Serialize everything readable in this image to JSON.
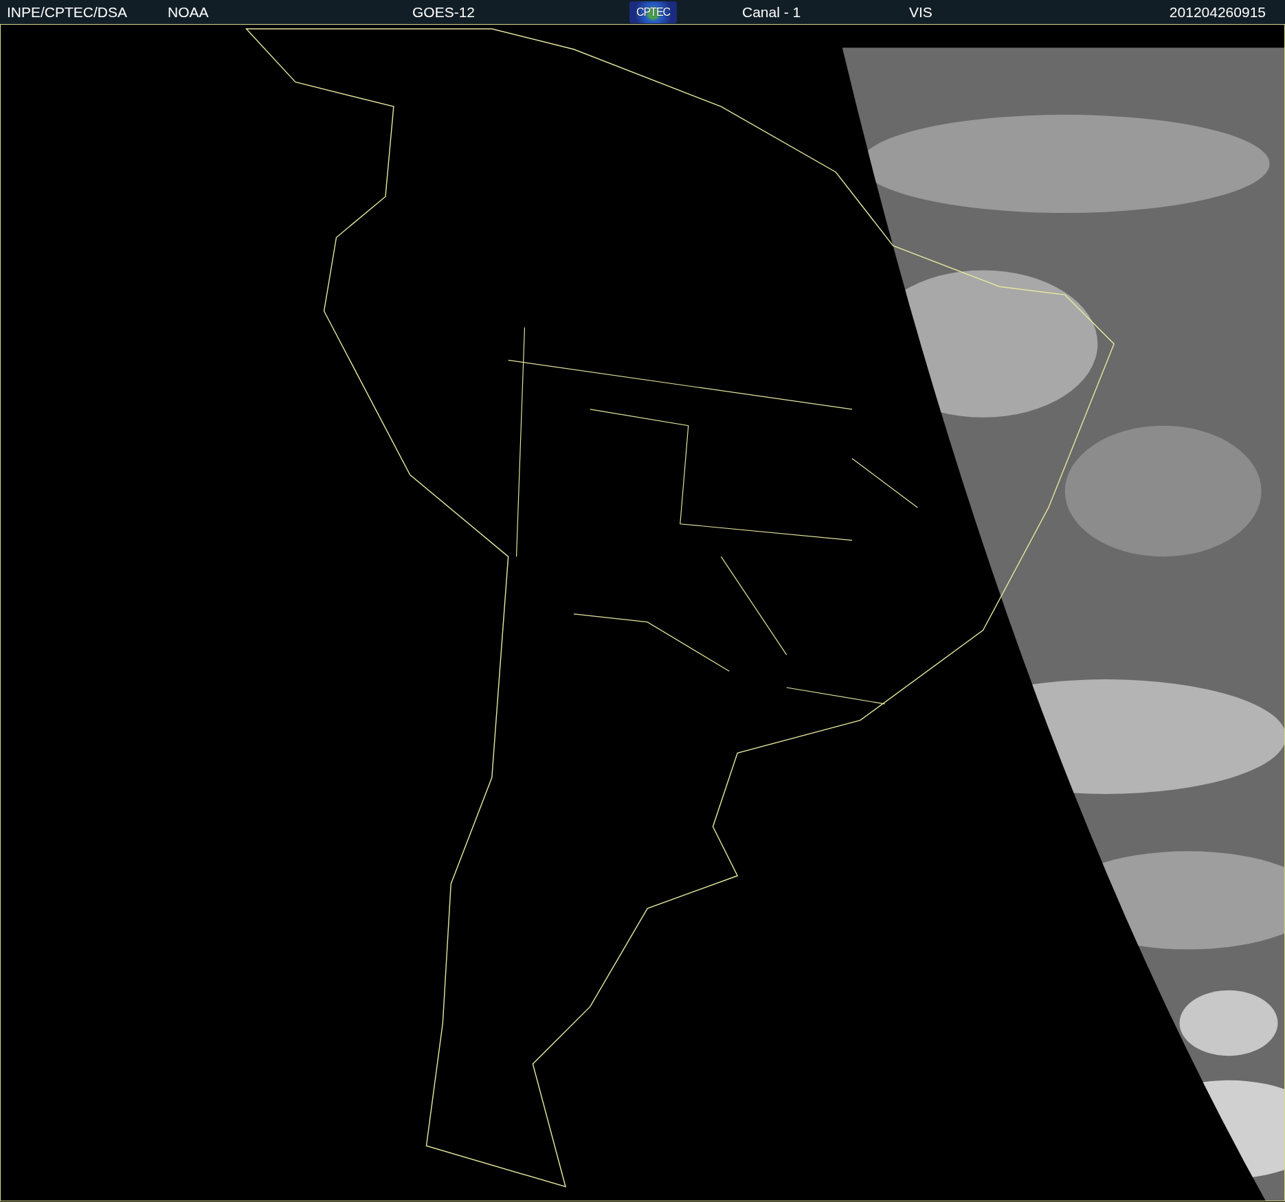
{
  "header": {
    "source": "INPE/CPTEC/DSA",
    "agency": "NOAA",
    "satellite": "GOES-12",
    "logo": "CPTEC",
    "channel": "Canal - 1",
    "band": "VIS",
    "timestamp": "201204260915"
  }
}
